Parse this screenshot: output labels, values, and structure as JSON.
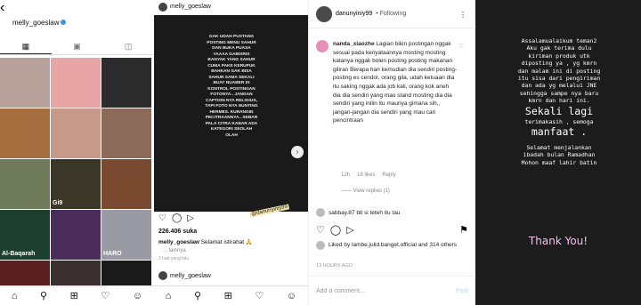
{
  "panel1": {
    "back": "‹",
    "username": "melly_goeslaw",
    "tabs": [
      "▦",
      "▣",
      "◫"
    ],
    "tiles": [
      {
        "color": "#b8a19a",
        "caption": ""
      },
      {
        "color": "#e8a5a5",
        "caption": ""
      },
      {
        "color": "#2b2b2b",
        "caption": ""
      },
      {
        "color": "#a46e3f",
        "caption": ""
      },
      {
        "color": "#c69a8a",
        "caption": ""
      },
      {
        "color": "#8b6a5a",
        "caption": ""
      },
      {
        "color": "#6e7a5a",
        "caption": ""
      },
      {
        "color": "#3a3628",
        "caption": "Gi9"
      },
      {
        "color": "#7a4a30",
        "caption": ""
      },
      {
        "color": "#1d3f2f",
        "caption": "Al-Baqarah"
      },
      {
        "color": "#4a2d5a",
        "caption": ""
      },
      {
        "color": "#9a9aa4",
        "caption": "HARO"
      },
      {
        "color": "#5a2020",
        "caption": ""
      },
      {
        "color": "#3a3030",
        "caption": ""
      },
      {
        "color": "#1a1a1a",
        "caption": ""
      }
    ],
    "nav": [
      "⌂",
      "⚲",
      "⊞",
      "♡",
      "☺"
    ]
  },
  "panel2": {
    "username": "melly_goeslaw",
    "post_text": "GAK UDAH PUSTANG POSTING MENU SAHUR DAN BUKA PUASA YAAAA GABISRIS BANYAK YANG SAHUR CUMA PAKE KERUPUK BAHKAN GAK BISA SAHUR SAMA SEKALI BUAT NUABER DI KONTROL POSTINGAN FOTONYA.. JANGAN CAPTION NYA RELIGIUS, TAPI FOTO NYA NUNTING HERMES. KURANGIN PECITRAANNYA.. SEBAR PALA CITRA KABAR ADA KATEGORI SEOLAH OLAH",
    "next": "›",
    "watermark": "@danunyiniy99",
    "actions": [
      "♡",
      "◯",
      "▷"
    ],
    "likes": "226.406 suka",
    "caption_user": "melly_goeslaw",
    "caption_text": "Selamat istirahat 🙏",
    "more": "... lainnya",
    "time": "3 hari yang lalu",
    "bottom_username": "melly_goeslaw",
    "nav": [
      "⌂",
      "⚲",
      "⊞",
      "♡",
      "☺"
    ]
  },
  "panel3": {
    "username": "danunyiniy99",
    "following": "• Following",
    "dots": "⋮",
    "comment_user": "nanda_xiaozhe",
    "comment_text": "Lagian bikin postingan nggak sesuai pada kenyataannya mosting mosting katanya nggak bolen posting posting makanan giliran Berapa hari kemudian dia sendiri posting-posting es cendol, orang gila, udah ketuaan dia itu saking nggak ada job kali, orang kok aneh dia dia sendiri yang mau stand mosting dia dia sendiri yang inilin itu maunya gimana sih,, jangan-jangan dia sendiri yang mau cari pencintraan",
    "comment_meta": [
      "12h",
      "18 likes",
      "Reply"
    ],
    "view_replies": "—— View replies (1)",
    "comment2": "sabbay.87 btl si teteh itu tau",
    "actions": [
      "♡",
      "◯",
      "▷"
    ],
    "bookmark": "⚑",
    "liked_by": "Liked by lambe.julid.banget.official and 314 others",
    "time": "13 HOURS AGO",
    "add_comment": "Add a comment...",
    "post_button": "Post"
  },
  "panel4": {
    "lines_top": [
      "Assalamualaikum teman2",
      "Aku gak terima dulu",
      "kiriman produk utk",
      "diposting ya , yg kmrn",
      "dan malam ini di posting",
      "itu sisa dari pengiriman",
      "dan ada yg melalui JNE",
      "sehingga sampe nya baru",
      "kmrn dan hari ini."
    ],
    "big1": "Sekali lagi",
    "mid": "terimakasih , semoga",
    "big2": "manfaat .",
    "lines_bottom": [
      "Selamat menjalankan",
      "ibadah bulan Ramadhan",
      "Mohon maaf lahir batin"
    ],
    "thanks": "Thank You!"
  }
}
